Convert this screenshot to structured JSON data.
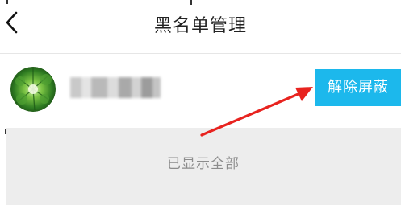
{
  "header": {
    "back_icon": "chevron-left-icon",
    "title": "黑名单管理"
  },
  "blocked_list": [
    {
      "avatar_icon": "avatar-green-foliage",
      "name": "",
      "unblock_label": "解除屏蔽"
    }
  ],
  "footer": {
    "end_text": "已显示全部"
  },
  "colors": {
    "accent": "#1cb8ec",
    "annotation_arrow": "#e8231f",
    "footer_bg": "#ededed"
  }
}
